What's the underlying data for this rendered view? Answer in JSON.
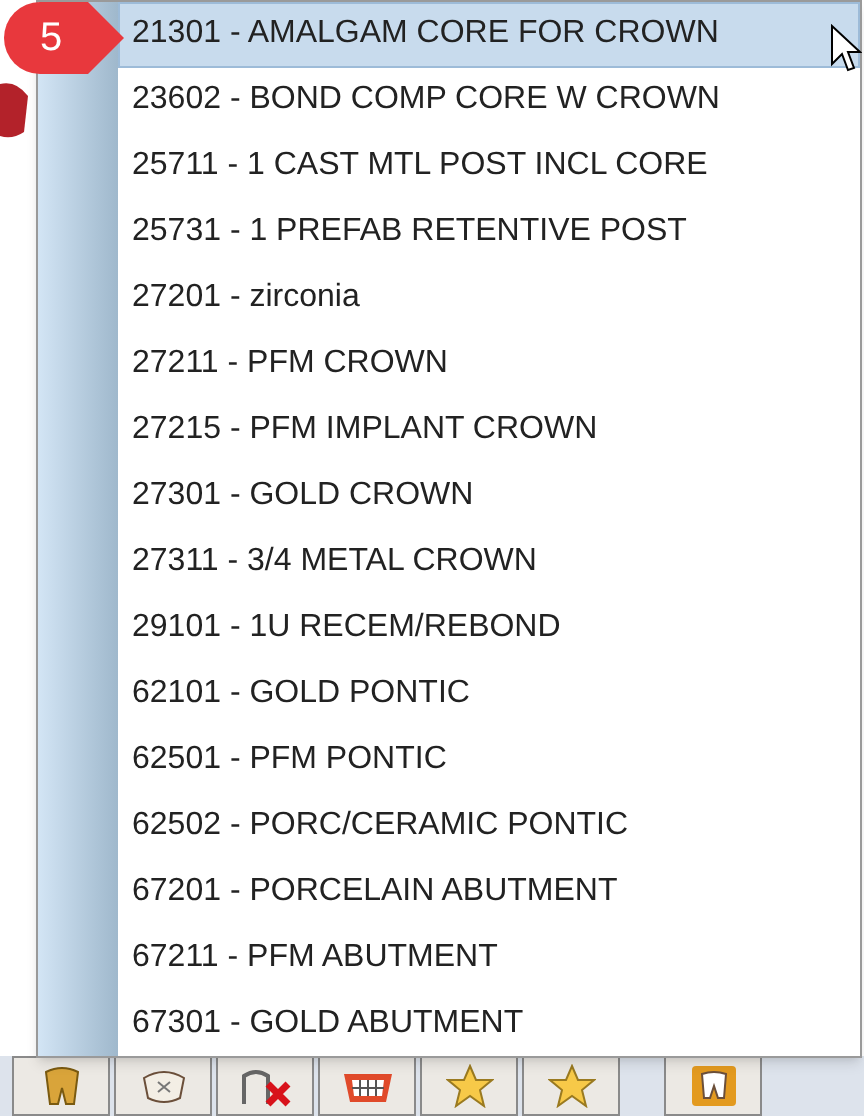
{
  "step_badge": {
    "label": "5"
  },
  "menu": {
    "items": [
      {
        "label": "21301 - AMALGAM CORE FOR CROWN",
        "selected": true
      },
      {
        "label": "23602 - BOND COMP CORE W CROWN",
        "selected": false
      },
      {
        "label": "25711 - 1 CAST MTL POST INCL CORE",
        "selected": false
      },
      {
        "label": "25731 - 1 PREFAB RETENTIVE POST",
        "selected": false
      },
      {
        "label": "27201 - zirconia",
        "selected": false
      },
      {
        "label": "27211 - PFM CROWN",
        "selected": false
      },
      {
        "label": "27215 - PFM IMPLANT CROWN",
        "selected": false
      },
      {
        "label": "27301 - GOLD CROWN",
        "selected": false
      },
      {
        "label": "27311 - 3/4 METAL CROWN",
        "selected": false
      },
      {
        "label": "29101 - 1U RECEM/REBOND",
        "selected": false
      },
      {
        "label": "62101 - GOLD PONTIC",
        "selected": false
      },
      {
        "label": "62501 - PFM PONTIC",
        "selected": false
      },
      {
        "label": "62502 - PORC/CERAMIC PONTIC",
        "selected": false
      },
      {
        "label": "67201 - PORCELAIN ABUTMENT",
        "selected": false
      },
      {
        "label": "67211 - PFM ABUTMENT",
        "selected": false
      },
      {
        "label": "67301 - GOLD ABUTMENT",
        "selected": false
      }
    ]
  },
  "toolbar": {
    "buttons": [
      {
        "kind": "gold-tooth"
      },
      {
        "kind": "white-tooth"
      },
      {
        "kind": "missing-tooth"
      },
      {
        "kind": "bridge"
      },
      {
        "kind": "star"
      },
      {
        "kind": "star"
      },
      {
        "kind": "gap"
      },
      {
        "kind": "orange-tooth"
      }
    ]
  }
}
